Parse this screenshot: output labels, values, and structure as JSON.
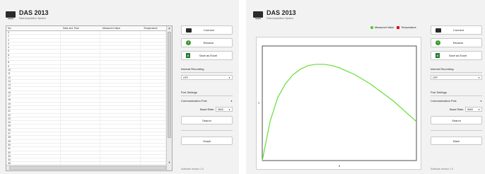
{
  "app": {
    "title": "DAS 2013",
    "subtitle": "Data Acquisition System",
    "version": "Software version 1.0"
  },
  "table": {
    "columns": [
      "No.",
      "Date and Time",
      "Measured Value",
      "Temperature"
    ],
    "rows": [
      "0",
      "1",
      "2",
      "3",
      "4",
      "5",
      "6",
      "7",
      "8",
      "9",
      "10",
      "11",
      "12",
      "13",
      "14",
      "15",
      "16",
      "17",
      "18",
      "19",
      "20",
      "21",
      "22",
      "23",
      "24",
      "25",
      "26",
      "27",
      "28",
      "29",
      "30",
      "31",
      "32",
      "33",
      "34",
      "35",
      "36"
    ]
  },
  "panel": {
    "connect_label": "Connect",
    "receive_label": "Receive",
    "save_label": "Save as Excel",
    "interval_label": "Interval Recording",
    "interval_value": "OFF",
    "port_settings_label": "Port Settings",
    "comm_port_label": "Communication Port:",
    "comm_port_value": "",
    "baud_rate_label": "Baud Rate:",
    "baud_rate_value": "9600",
    "search_label": "Search",
    "graph_label": "Graph",
    "back_label": "Back"
  },
  "chart_data": {
    "type": "line",
    "title": "",
    "xlabel": "X",
    "ylabel": "Y",
    "legend": [
      {
        "name": "Measured Value",
        "color": "#44cc22"
      },
      {
        "name": "Temperature",
        "color": "#dd1111"
      }
    ],
    "legend_placement": "top-right",
    "series": [
      {
        "name": "Measured Value",
        "color": "#66dd33",
        "x": [
          0,
          0.05,
          0.1,
          0.15,
          0.2,
          0.25,
          0.3,
          0.35,
          0.4,
          0.45,
          0.5,
          0.55,
          0.6,
          0.65,
          0.7,
          0.75,
          0.8,
          0.85,
          0.9,
          0.95,
          1.0
        ],
        "y": [
          0,
          0.34,
          0.55,
          0.67,
          0.75,
          0.8,
          0.83,
          0.84,
          0.84,
          0.83,
          0.81,
          0.78,
          0.75,
          0.71,
          0.67,
          0.62,
          0.57,
          0.52,
          0.46,
          0.4,
          0.34
        ]
      }
    ],
    "xlim": [
      0,
      1
    ],
    "ylim": [
      0,
      1
    ],
    "grid": false
  }
}
